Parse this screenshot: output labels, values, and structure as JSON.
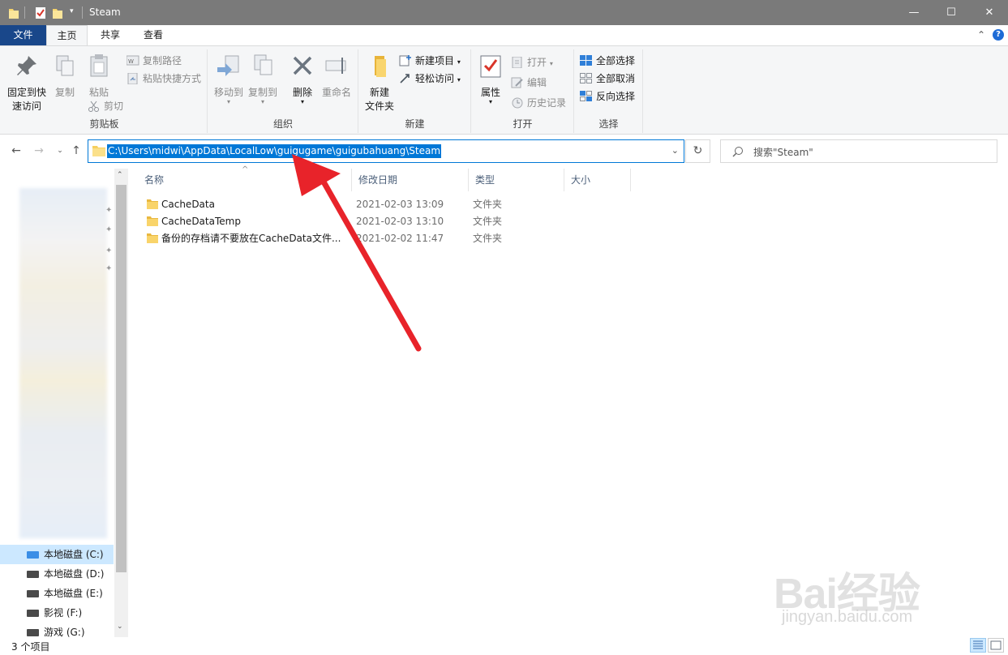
{
  "window": {
    "title": "Steam",
    "controls": {
      "minimize": "—",
      "maximize": "☐",
      "close": "✕"
    }
  },
  "ribbon_tabs": {
    "file": "文件",
    "home": "主页",
    "share": "共享",
    "view": "查看"
  },
  "ribbon": {
    "clipboard": {
      "label": "剪贴板",
      "pin": "固定到快速访问",
      "pin_line1": "固定到快",
      "pin_line2": "速访问",
      "copy": "复制",
      "paste": "粘贴",
      "copy_path": "复制路径",
      "paste_shortcut": "粘贴快捷方式",
      "cut": "剪切"
    },
    "organize": {
      "label": "组织",
      "move_to": "移动到",
      "copy_to": "复制到",
      "delete": "删除",
      "rename": "重命名"
    },
    "new": {
      "label": "新建",
      "new_folder_line1": "新建",
      "new_folder_line2": "文件夹",
      "new_item": "新建项目",
      "easy_access": "轻松访问"
    },
    "open": {
      "label": "打开",
      "properties": "属性",
      "open": "打开",
      "edit": "编辑",
      "history": "历史记录"
    },
    "select": {
      "label": "选择",
      "select_all": "全部选择",
      "select_none": "全部取消",
      "invert": "反向选择"
    }
  },
  "address_bar": {
    "path": "C:\\Users\\midwi\\AppData\\LocalLow\\guigugame\\guigubahuang\\Steam"
  },
  "search": {
    "placeholder": "搜索\"Steam\""
  },
  "columns": {
    "name": "名称",
    "modified": "修改日期",
    "type": "类型",
    "size": "大小"
  },
  "files": [
    {
      "name": "CacheData",
      "modified": "2021-02-03 13:09",
      "type": "文件夹"
    },
    {
      "name": "CacheDataTemp",
      "modified": "2021-02-03 13:10",
      "type": "文件夹"
    },
    {
      "name": "备份的存档请不要放在CacheData文件...",
      "modified": "2021-02-02 11:47",
      "type": "文件夹"
    }
  ],
  "nav_pane": {
    "drives": [
      {
        "label": "本地磁盘 (C:)",
        "selected": true
      },
      {
        "label": "本地磁盘 (D:)",
        "selected": false
      },
      {
        "label": "本地磁盘 (E:)",
        "selected": false
      },
      {
        "label": "影视 (F:)",
        "selected": false
      },
      {
        "label": "游戏 (G:)",
        "selected": false
      }
    ]
  },
  "status_bar": {
    "item_count": "3 个项目"
  },
  "watermark": {
    "main": "Bai经验",
    "sub": "jingyan.baidu.com"
  },
  "colors": {
    "titlebar": "#7a7a7a",
    "file_tab": "#19478a",
    "selection": "#0078d7",
    "selected_drive": "#cce8ff",
    "arrow": "#e8232a"
  }
}
